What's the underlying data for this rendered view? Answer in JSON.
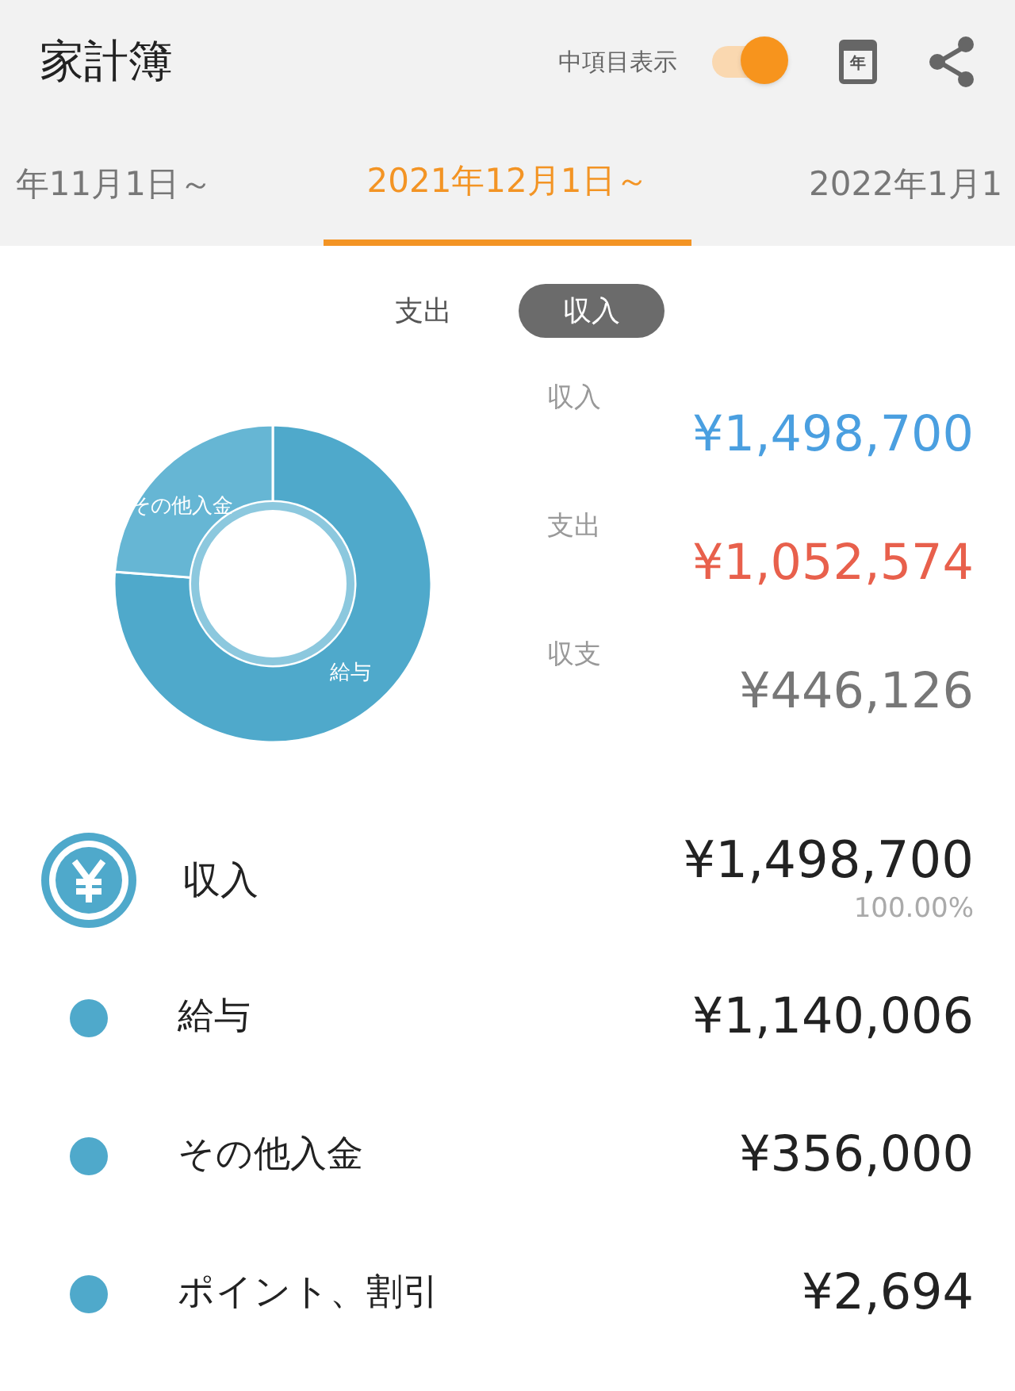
{
  "header": {
    "title": "家計簿",
    "toggle": {
      "label": "中項目表示",
      "on": true
    },
    "calendar_icon_text": "年"
  },
  "period_tabs": [
    {
      "label": "年11月1日～",
      "selected": false
    },
    {
      "label": "2021年12月1日～",
      "selected": true
    },
    {
      "label": "2022年1月1",
      "selected": false
    }
  ],
  "type_switch": [
    {
      "label": "支出",
      "selected": false
    },
    {
      "label": "収入",
      "selected": true
    }
  ],
  "chart": {
    "chart_data": {
      "type": "donut",
      "categories": [
        "給与",
        "その他入金"
      ],
      "values": [
        76.2,
        23.8
      ]
    }
  },
  "summary": [
    {
      "label": "収入",
      "value": "¥1,498,700",
      "color": "#4a9fe0"
    },
    {
      "label": "支出",
      "value": "¥1,052,574",
      "color": "#e8604c"
    },
    {
      "label": "収支",
      "value": "¥446,126",
      "color": "#777777"
    }
  ],
  "category": {
    "name": "収入",
    "amount": "¥1,498,700",
    "percent": "100.00%"
  },
  "items": [
    {
      "name": "給与",
      "amount": "¥1,140,006",
      "color": "#4fa9cb"
    },
    {
      "name": "その他入金",
      "amount": "¥356,000",
      "color": "#4fa9cb"
    },
    {
      "name": "ポイント、割引",
      "amount": "¥2,694",
      "color": "#4fa9cb"
    }
  ]
}
